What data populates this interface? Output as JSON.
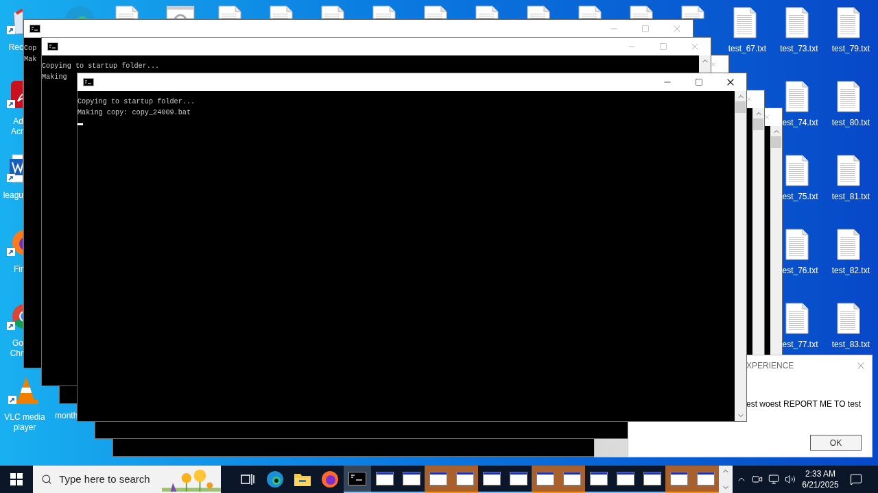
{
  "desktop": {
    "left_icons": [
      {
        "kind": "recycle-bin",
        "label_lines": [
          "Rec"
        ]
      },
      {
        "kind": "acrobat",
        "label_lines": [
          "Ad",
          "Acr"
        ]
      },
      {
        "kind": "word",
        "label_lines": [
          "leagu"
        ]
      },
      {
        "kind": "firefox",
        "label_lines": [
          "Fir"
        ]
      },
      {
        "kind": "chrome",
        "label_lines": [
          "Go",
          "Chr"
        ]
      },
      {
        "kind": "vlc",
        "label_lines": [
          "VLC media player"
        ]
      }
    ],
    "month_label": "month",
    "top_icons": [
      {
        "kind": "edge"
      },
      {
        "kind": "document"
      },
      {
        "kind": "setup"
      },
      {
        "kind": "document"
      },
      {
        "kind": "document"
      },
      {
        "kind": "document"
      },
      {
        "kind": "document"
      },
      {
        "kind": "document"
      },
      {
        "kind": "document"
      },
      {
        "kind": "document"
      },
      {
        "kind": "document"
      },
      {
        "kind": "document"
      },
      {
        "kind": "document"
      }
    ],
    "right_icons": [
      [
        {
          "label": "test_67.txt"
        }
      ],
      [
        {
          "label": "test_73.txt"
        },
        {
          "label": "est_74.txt"
        },
        {
          "label": "est_75.txt"
        },
        {
          "label": "est_76.txt"
        },
        {
          "label": "est_77.txt"
        }
      ],
      [
        {
          "label": "test_79.txt"
        },
        {
          "label": "test_80.txt"
        },
        {
          "label": "test_81.txt"
        },
        {
          "label": "test_82.txt"
        },
        {
          "label": "test_83.txt"
        }
      ]
    ]
  },
  "windows": [
    {
      "lines": [
        "Cop",
        "Mak"
      ],
      "active": false
    },
    {
      "lines": [
        "Copying to startup folder...",
        "Making"
      ],
      "active": false
    },
    {
      "active": false
    },
    {
      "lines": [
        "Copying to startup folder...",
        "Making copy: copy_24009.bat"
      ],
      "active": true,
      "cursor": true
    },
    {
      "active": false
    },
    {
      "active": false
    }
  ],
  "dialog": {
    "title": "XPERIENCE",
    "message": "est woest REPORT ME TO test",
    "button": "OK"
  },
  "taskbar": {
    "search": {
      "placeholder": "Type here to search"
    },
    "pinned": [
      {
        "kind": "task-view",
        "selected": false
      },
      {
        "kind": "edge",
        "selected": false
      },
      {
        "kind": "explorer",
        "selected": false
      },
      {
        "kind": "firefox",
        "selected": false
      },
      {
        "kind": "terminal",
        "selected": true
      }
    ],
    "windows": [
      {
        "flashing": false
      },
      {
        "flashing": false
      },
      {
        "flashing": true
      },
      {
        "flashing": true
      },
      {
        "flashing": false
      },
      {
        "flashing": false
      },
      {
        "flashing": true
      },
      {
        "flashing": true
      },
      {
        "flashing": false
      },
      {
        "flashing": false
      },
      {
        "flashing": false
      },
      {
        "flashing": true
      },
      {
        "flashing": true
      }
    ],
    "clock": {
      "time": "2:33 AM",
      "date": "6/21/2025"
    }
  }
}
